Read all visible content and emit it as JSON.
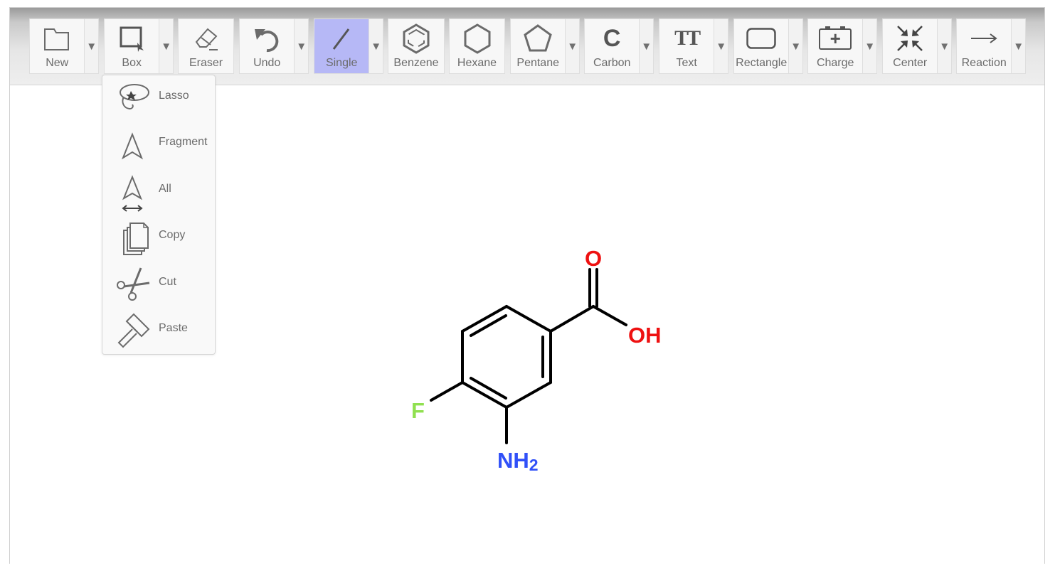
{
  "toolbar": {
    "tools": [
      {
        "label": "New",
        "icon": "folder-icon",
        "has_dropdown": true
      },
      {
        "label": "Box",
        "icon": "box-select-icon",
        "has_dropdown": true
      },
      {
        "label": "Eraser",
        "icon": "eraser-icon",
        "has_dropdown": false
      },
      {
        "label": "Undo",
        "icon": "undo-icon",
        "has_dropdown": true
      },
      {
        "label": "Single",
        "icon": "single-bond-icon",
        "has_dropdown": true,
        "active": true
      },
      {
        "label": "Benzene",
        "icon": "benzene-icon",
        "has_dropdown": false
      },
      {
        "label": "Hexane",
        "icon": "hexagon-icon",
        "has_dropdown": false
      },
      {
        "label": "Pentane",
        "icon": "pentagon-icon",
        "has_dropdown": true
      },
      {
        "label": "Carbon",
        "icon": "carbon-icon",
        "has_dropdown": true
      },
      {
        "label": "Text",
        "icon": "text-icon",
        "has_dropdown": true
      },
      {
        "label": "Rectangle",
        "icon": "rectangle-icon",
        "has_dropdown": true
      },
      {
        "label": "Charge",
        "icon": "charge-icon",
        "has_dropdown": true
      },
      {
        "label": "Center",
        "icon": "center-icon",
        "has_dropdown": true
      },
      {
        "label": "Reaction",
        "icon": "reaction-arrow-icon",
        "has_dropdown": true
      }
    ],
    "carbon_glyph": "C",
    "text_glyph": "TT",
    "charge_glyph": "+"
  },
  "selection_menu": {
    "items": [
      {
        "label": "Lasso",
        "icon": "lasso-icon"
      },
      {
        "label": "Fragment",
        "icon": "fragment-select-icon"
      },
      {
        "label": "All",
        "icon": "select-all-icon"
      },
      {
        "label": "Copy",
        "icon": "copy-icon"
      },
      {
        "label": "Cut",
        "icon": "scissors-icon"
      },
      {
        "label": "Paste",
        "icon": "paste-icon"
      }
    ]
  },
  "molecule": {
    "atom_labels": {
      "carbonyl_oxygen": "O",
      "hydroxyl": "OH",
      "fluorine": "F",
      "amine": "NH",
      "amine_subscript": "2"
    },
    "colors": {
      "bond": "#000000",
      "oxygen": "#ee1111",
      "fluorine": "#90e050",
      "nitrogen": "#3050f8"
    }
  },
  "colors": {
    "active_tool": "#b6b8f6",
    "icon_gray": "#6b6b6b",
    "label_gray": "#6b6b6b"
  }
}
